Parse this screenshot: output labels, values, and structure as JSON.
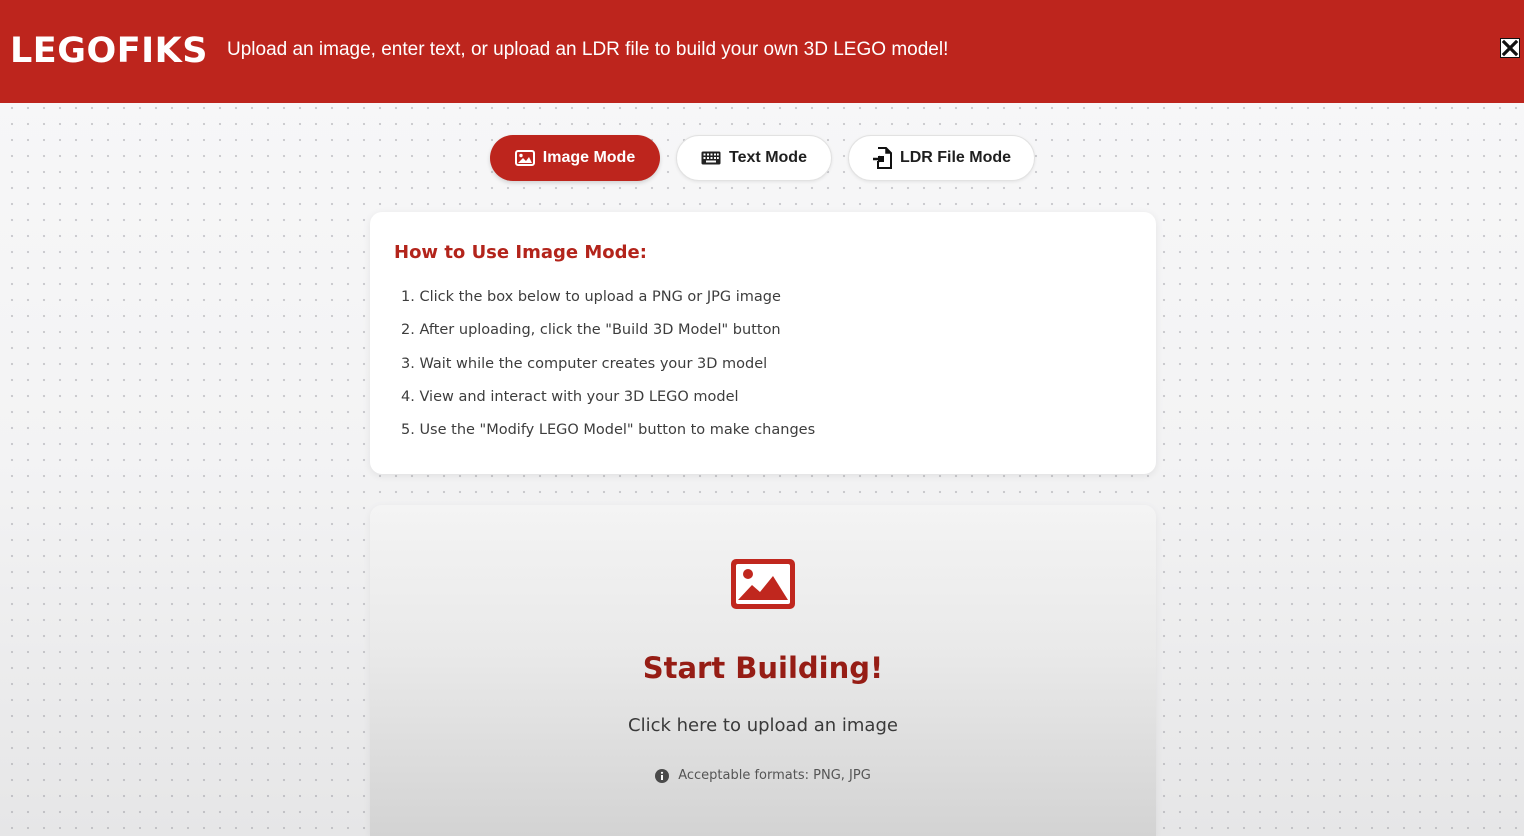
{
  "header": {
    "logo": "LEGOFIKS",
    "tagline": "Upload an image, enter text, or upload an LDR file to build your own 3D LEGO model!",
    "close_icon": "close-icon"
  },
  "modes": [
    {
      "label": "Image Mode",
      "icon": "image-icon",
      "active": true
    },
    {
      "label": "Text Mode",
      "icon": "keyboard-icon",
      "active": false
    },
    {
      "label": "LDR File Mode",
      "icon": "file-import-icon",
      "active": false
    }
  ],
  "instructions": {
    "title": "How to Use Image Mode:",
    "steps": [
      "1. Click the box below to upload a PNG or JPG image",
      "2. After uploading, click the \"Build 3D Model\" button",
      "3. Wait while the computer creates your 3D model",
      "4. View and interact with your 3D LEGO model",
      "5. Use the \"Modify LEGO Model\" button to make changes"
    ]
  },
  "upload": {
    "icon": "image-icon",
    "title": "Start Building!",
    "subtitle": "Click here to upload an image",
    "formats": "Acceptable formats: PNG, JPG",
    "info_icon": "info-icon"
  },
  "colors": {
    "brand_red": "#bd251d",
    "title_red": "#961d15",
    "text_dark": "#1f1f1f"
  }
}
